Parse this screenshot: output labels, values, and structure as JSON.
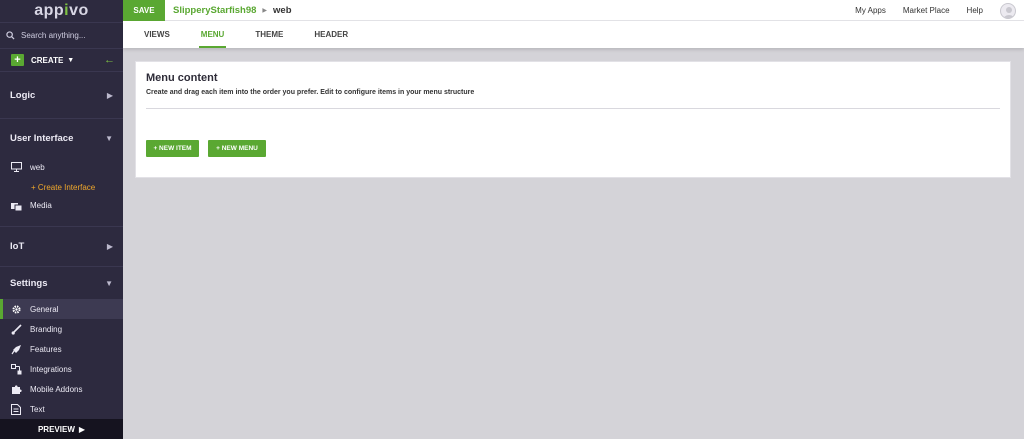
{
  "brand": {
    "logo_main": "app",
    "logo_accent": "i",
    "logo_end": "vo",
    "accent_color": "#5aa832"
  },
  "sidebar": {
    "search_placeholder": "Search anything...",
    "create_label": "CREATE",
    "sections": {
      "logic": "Logic",
      "user_interface": "User Interface",
      "iot": "IoT",
      "settings": "Settings"
    },
    "ui_items": [
      {
        "label": "web",
        "icon": "monitor-icon"
      },
      {
        "label": "+ Create Interface",
        "icon": ""
      },
      {
        "label": "Media",
        "icon": "media-icon"
      }
    ],
    "settings_items": [
      {
        "label": "General",
        "icon": "gear-icon",
        "active": true
      },
      {
        "label": "Branding",
        "icon": "brush-icon"
      },
      {
        "label": "Features",
        "icon": "rocket-icon"
      },
      {
        "label": "Integrations",
        "icon": "integrations-icon"
      },
      {
        "label": "Mobile Addons",
        "icon": "puzzle-icon"
      },
      {
        "label": "Text",
        "icon": "document-icon"
      }
    ],
    "preview_label": "PREVIEW"
  },
  "topbar": {
    "save_label": "SAVE",
    "app_name": "SlipperyStarfish98",
    "page_name": "web",
    "links": [
      "My Apps",
      "Market Place",
      "Help"
    ]
  },
  "tabs": [
    {
      "label": "VIEWS",
      "active": false
    },
    {
      "label": "MENU",
      "active": true
    },
    {
      "label": "THEME",
      "active": false
    },
    {
      "label": "HEADER",
      "active": false
    }
  ],
  "card": {
    "title": "Menu content",
    "subtitle": "Create and drag each item into the order you prefer. Edit to configure items in your menu structure",
    "new_item_label": "+ NEW ITEM",
    "new_menu_label": "+ NEW MENU"
  }
}
